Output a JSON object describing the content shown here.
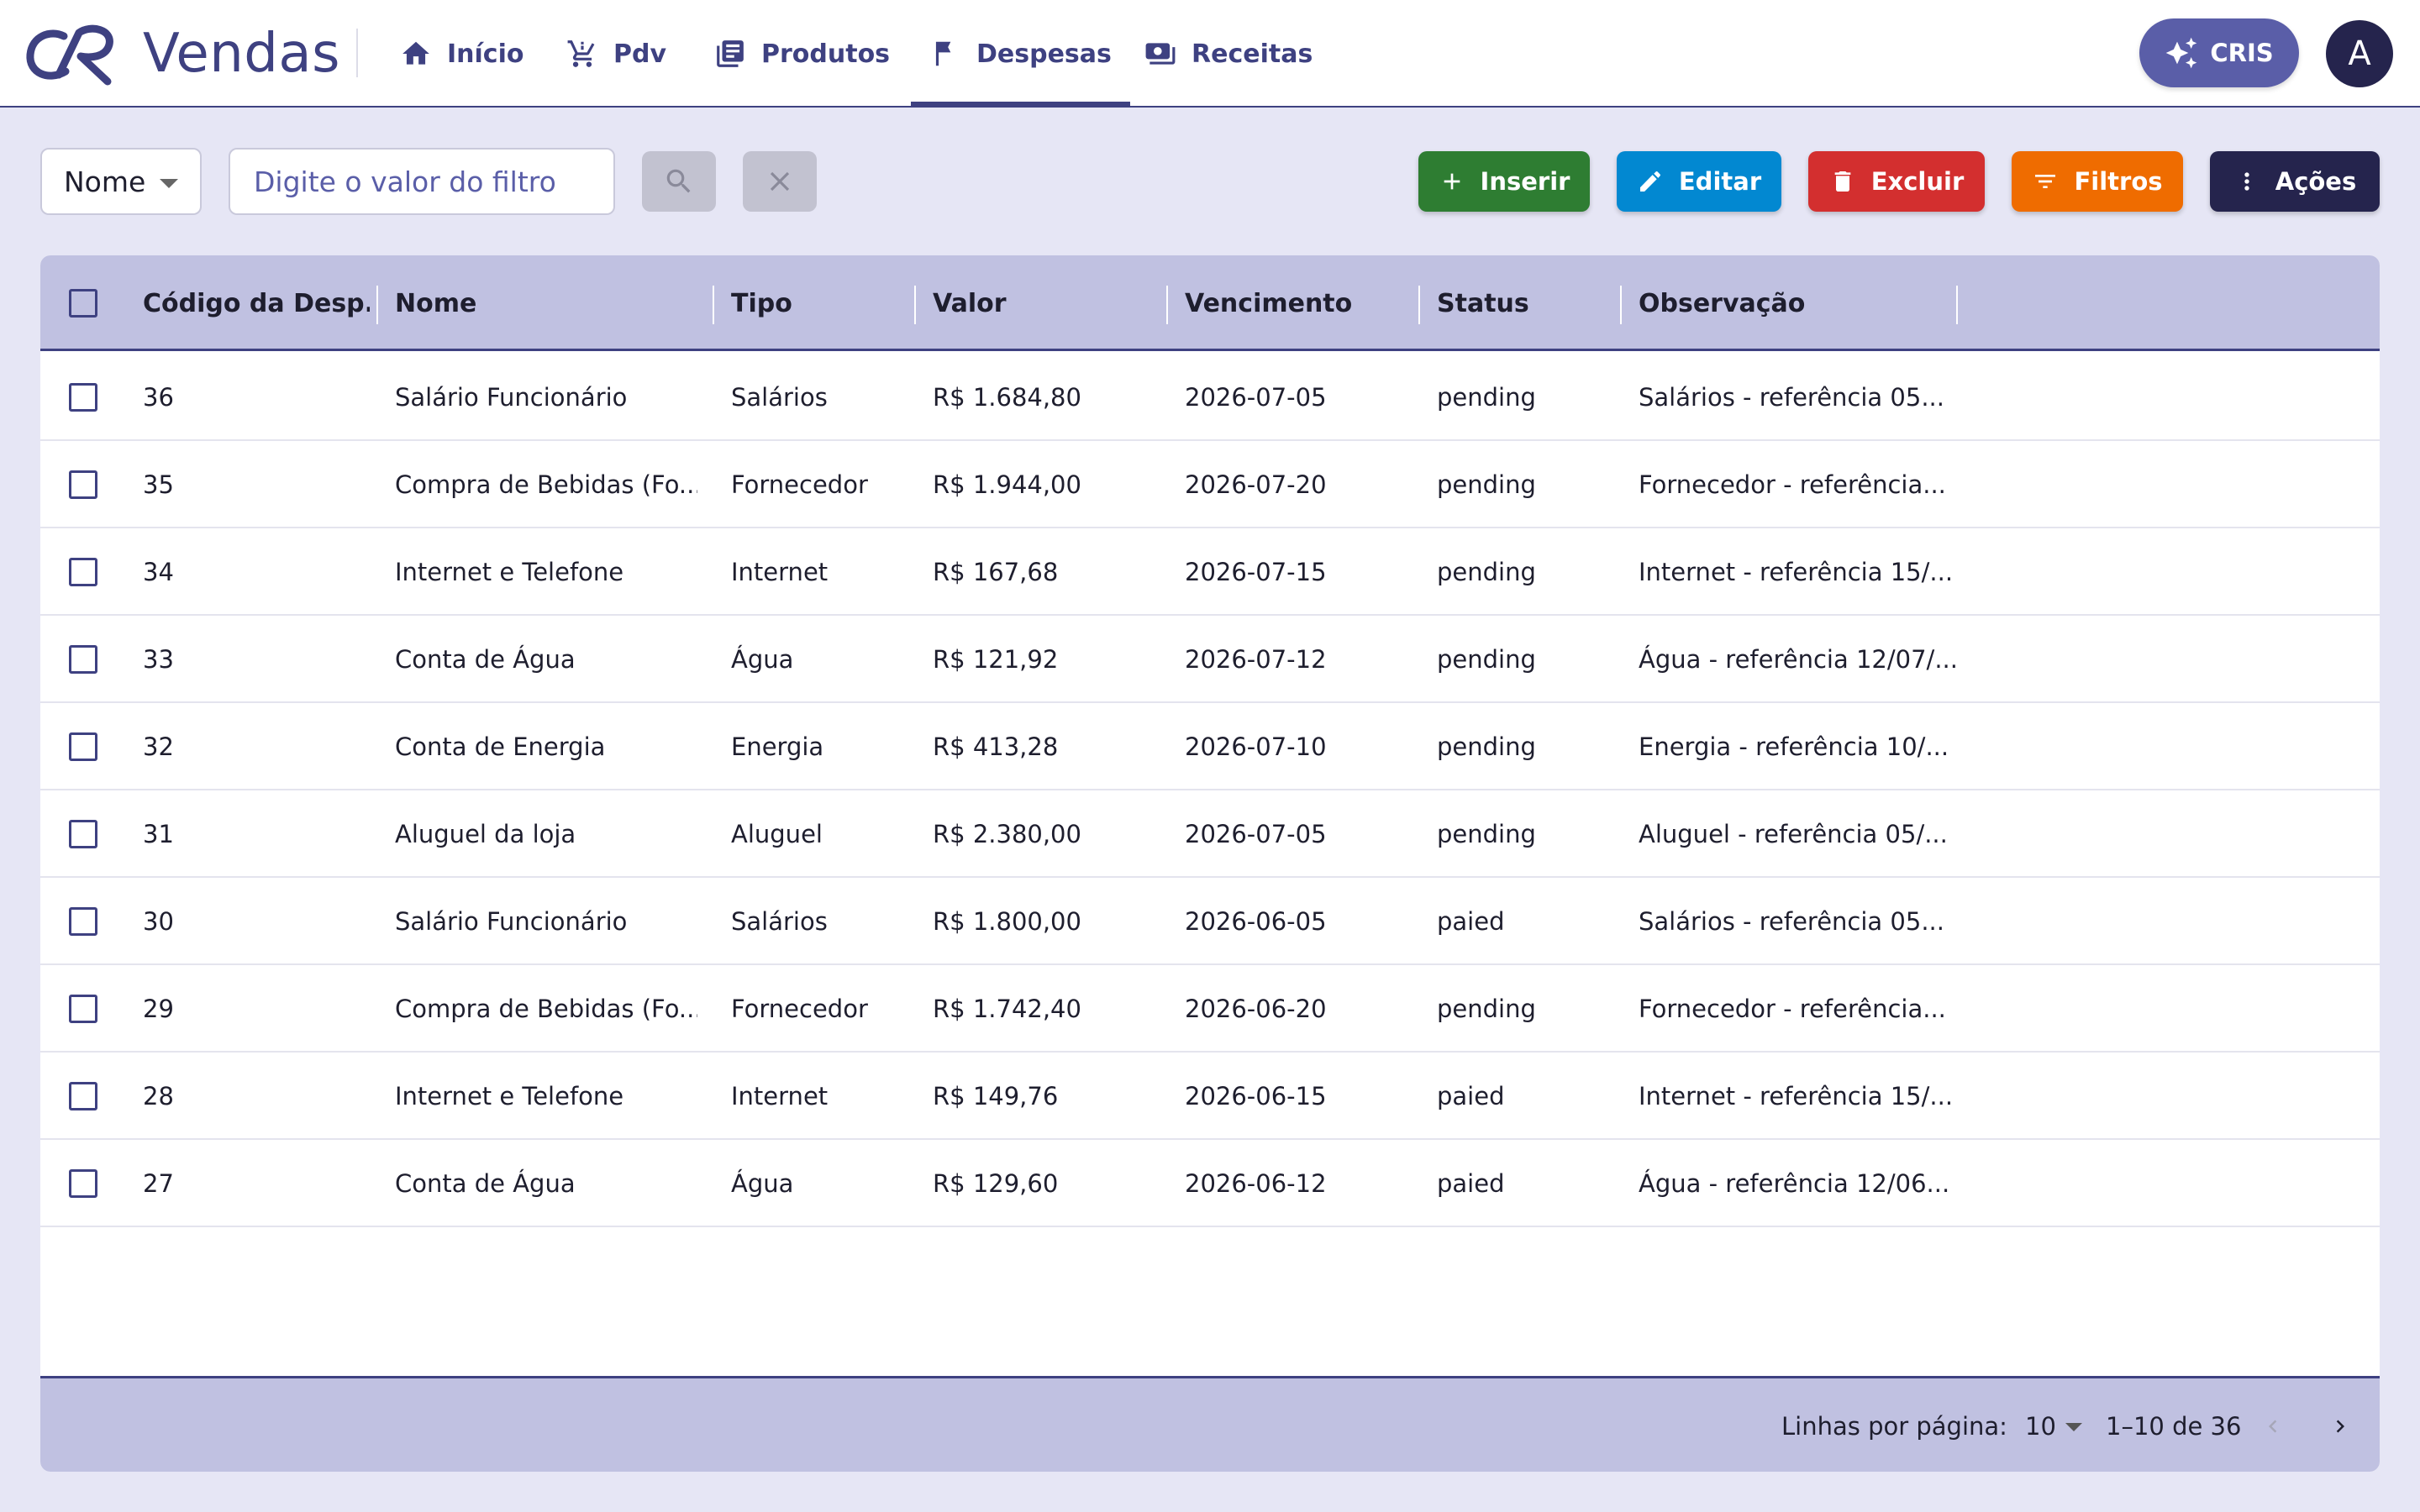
{
  "app": {
    "brand": "Vendas",
    "nav": [
      {
        "label": "Início",
        "icon": "home-icon"
      },
      {
        "label": "Pdv",
        "icon": "cart-icon"
      },
      {
        "label": "Produtos",
        "icon": "product-icon"
      },
      {
        "label": "Despesas",
        "icon": "bookmark-icon",
        "active": true
      },
      {
        "label": "Receitas",
        "icon": "cash-icon"
      }
    ],
    "cris_label": "CRIS",
    "avatar_letter": "A"
  },
  "toolbar": {
    "filter_field": "Nome",
    "filter_placeholder": "Digite o valor do filtro",
    "buttons": [
      {
        "label": "Inserir",
        "icon": "plus-icon",
        "color": "#2e7d32"
      },
      {
        "label": "Editar",
        "icon": "pencil-icon",
        "color": "#0288d1"
      },
      {
        "label": "Excluir",
        "icon": "trash-icon",
        "color": "#d32f2f"
      },
      {
        "label": "Filtros",
        "icon": "filter-icon",
        "color": "#ef6c00"
      },
      {
        "label": "Ações",
        "icon": "more-vert-icon",
        "color": "#25244d"
      }
    ]
  },
  "table": {
    "columns": [
      "Código da Desp...",
      "Nome",
      "Tipo",
      "Valor",
      "Vencimento",
      "Status",
      "Observação"
    ],
    "rows": [
      {
        "codigo": "36",
        "nome": "Salário Funcionário",
        "tipo": "Salários",
        "valor": "R$ 1.684,80",
        "vencimento": "2026-07-05",
        "status": "pending",
        "observacao": "Salários - referência 05..."
      },
      {
        "codigo": "35",
        "nome": "Compra de Bebidas (Fo...",
        "tipo": "Fornecedor",
        "valor": "R$ 1.944,00",
        "vencimento": "2026-07-20",
        "status": "pending",
        "observacao": "Fornecedor - referência..."
      },
      {
        "codigo": "34",
        "nome": "Internet e Telefone",
        "tipo": "Internet",
        "valor": "R$ 167,68",
        "vencimento": "2026-07-15",
        "status": "pending",
        "observacao": "Internet - referência 15/..."
      },
      {
        "codigo": "33",
        "nome": "Conta de Água",
        "tipo": "Água",
        "valor": "R$ 121,92",
        "vencimento": "2026-07-12",
        "status": "pending",
        "observacao": "Água - referência 12/07/..."
      },
      {
        "codigo": "32",
        "nome": "Conta de Energia",
        "tipo": "Energia",
        "valor": "R$ 413,28",
        "vencimento": "2026-07-10",
        "status": "pending",
        "observacao": "Energia - referência 10/..."
      },
      {
        "codigo": "31",
        "nome": "Aluguel da loja",
        "tipo": "Aluguel",
        "valor": "R$ 2.380,00",
        "vencimento": "2026-07-05",
        "status": "pending",
        "observacao": "Aluguel - referência 05/..."
      },
      {
        "codigo": "30",
        "nome": "Salário Funcionário",
        "tipo": "Salários",
        "valor": "R$ 1.800,00",
        "vencimento": "2026-06-05",
        "status": "paied",
        "observacao": "Salários - referência 05..."
      },
      {
        "codigo": "29",
        "nome": "Compra de Bebidas (Fo...",
        "tipo": "Fornecedor",
        "valor": "R$ 1.742,40",
        "vencimento": "2026-06-20",
        "status": "pending",
        "observacao": "Fornecedor - referência..."
      },
      {
        "codigo": "28",
        "nome": "Internet e Telefone",
        "tipo": "Internet",
        "valor": "R$ 149,76",
        "vencimento": "2026-06-15",
        "status": "paied",
        "observacao": "Internet - referência 15/..."
      },
      {
        "codigo": "27",
        "nome": "Conta de Água",
        "tipo": "Água",
        "valor": "R$ 129,60",
        "vencimento": "2026-06-12",
        "status": "paied",
        "observacao": "Água - referência 12/06..."
      }
    ]
  },
  "pagination": {
    "rows_per_page_label": "Linhas por página:",
    "rows_per_page": "10",
    "range": "1–10 de 36"
  }
}
